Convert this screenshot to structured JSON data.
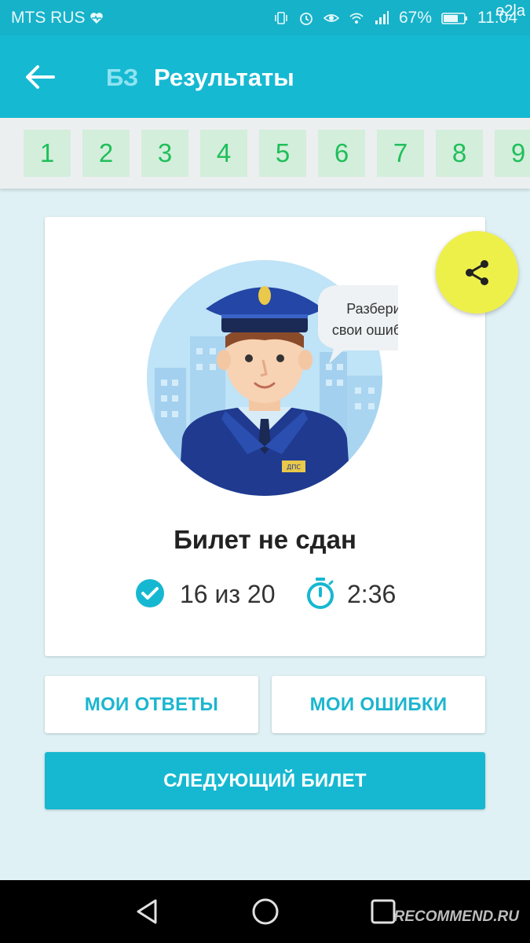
{
  "status_bar": {
    "carrier": "MTS RUS",
    "battery": "67%",
    "time": "11:04",
    "watermark": "e2la"
  },
  "app_bar": {
    "badge": "БЗ",
    "title": "Результаты"
  },
  "question_tabs": [
    "1",
    "2",
    "3",
    "4",
    "5",
    "6",
    "7",
    "8",
    "9"
  ],
  "card": {
    "speech_bubble_line1": "Разбери",
    "speech_bubble_line2": "свои ошибки",
    "badge_text": "ДПС",
    "result_title": "Билет не сдан",
    "score": "16 из 20",
    "time": "2:36"
  },
  "buttons": {
    "my_answers": "МОИ ОТВЕТЫ",
    "my_errors": "МОИ ОШИБКИ",
    "next_ticket": "СЛЕДУЮЩИЙ БИЛЕТ"
  },
  "nav_bar": {
    "watermark": "RECOMMEND.RU"
  },
  "colors": {
    "primary": "#16b9d2",
    "accent_green": "#1fbf5a",
    "fab": "#eef04a",
    "background": "#dff1f5"
  }
}
